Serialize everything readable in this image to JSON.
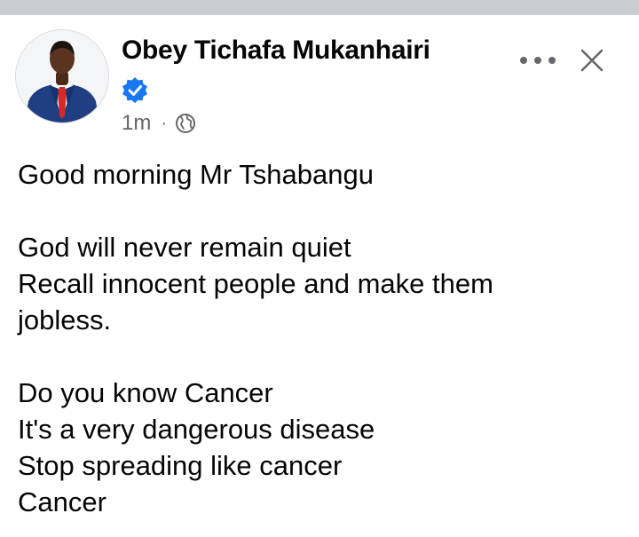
{
  "post": {
    "author": {
      "name": "Obey Tichafa Mukanhairi",
      "verified": true,
      "avatar_icon": "profile-photo-man-in-suit"
    },
    "meta": {
      "time": "1m",
      "separator": "·",
      "audience_icon": "globe-icon"
    },
    "actions": {
      "more_icon": "more-options-icon",
      "close_icon": "close-icon"
    },
    "body": {
      "line1": "Good morning Mr Tshabangu",
      "line2": "God will never remain quiet",
      "line3": "Recall innocent people and make them",
      "line4": "jobless.",
      "line5": "Do you know Cancer",
      "line6": "It's a very dangerous disease",
      "line7": "Stop spreading like cancer",
      "line8": "Cancer"
    }
  },
  "colors": {
    "verified_blue": "#1877f2",
    "meta_gray": "#65676b",
    "divider_gray": "#c9ccd1",
    "text": "#050505"
  }
}
